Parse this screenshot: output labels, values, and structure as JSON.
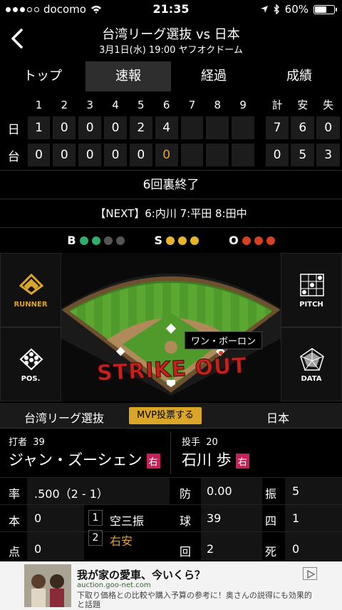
{
  "status": {
    "carrier": "docomo",
    "time": "21:35",
    "battery": "60%"
  },
  "header": {
    "title": "台湾リーグ選抜 vs 日本",
    "subtitle": "3月1日(水) 19:00 ヤフオクドーム"
  },
  "tabs": [
    "トップ",
    "速報",
    "経過",
    "成績"
  ],
  "scoreboard": {
    "innings": [
      "1",
      "2",
      "3",
      "4",
      "5",
      "6",
      "7",
      "8",
      "9"
    ],
    "totals_headers": [
      "計",
      "安",
      "失"
    ],
    "teams": [
      {
        "abbr": "日",
        "runs": [
          "1",
          "0",
          "0",
          "0",
          "2",
          "4",
          "",
          "",
          ""
        ],
        "totals": [
          "7",
          "6",
          "0"
        ]
      },
      {
        "abbr": "台",
        "runs": [
          "0",
          "0",
          "0",
          "0",
          "0",
          "0",
          "",
          "",
          ""
        ],
        "totals": [
          "0",
          "5",
          "3"
        ]
      }
    ]
  },
  "inning_status": "6回裏終了",
  "next_batters": "【NEXT】6:内川  7:平田  8:田中",
  "count": {
    "b_label": "B",
    "s_label": "S",
    "o_label": "O",
    "balls": 2,
    "strikes": 3,
    "outs": 3,
    "colors": {
      "ball": "#2fae6a",
      "strike": "#e8b52a",
      "out": "#d64020",
      "off": "#555555"
    }
  },
  "field": {
    "fielder_label": "ワン・ボーロン",
    "result_text": "STRIKE OUT"
  },
  "side_buttons": {
    "runner": "RUNNER",
    "pos": "POS.",
    "pitch": "PITCH",
    "data": "DATA"
  },
  "teams_bar": {
    "home": "台湾リーグ選抜",
    "mvp": "MVP投票する",
    "away": "日本"
  },
  "batter": {
    "role": "打者",
    "number": "39",
    "name": "ジャン・ズーシェン",
    "hand": "右"
  },
  "pitcher": {
    "role": "投手",
    "number": "20",
    "name": "石川 歩",
    "hand": "右"
  },
  "batter_stats": {
    "avg_label": "率",
    "avg": ".500（2 - 1）",
    "hr_label": "本",
    "hr": "0",
    "rbi_label": "点",
    "rbi": "0",
    "at_bats": [
      {
        "n": "1",
        "result": "空三振"
      },
      {
        "n": "2",
        "result": "右安"
      }
    ]
  },
  "pitcher_stats": {
    "era_label": "防",
    "era": "0.00",
    "k_label": "振",
    "k": "5",
    "pitches_label": "球",
    "pitches": "39",
    "bb_label": "四",
    "bb": "1",
    "ip_label": "回",
    "ip": "2",
    "dead_label": "死",
    "dead": "0"
  },
  "ad": {
    "headline": "我が家の愛車、今いくら？",
    "url": "auction.goo-net.com",
    "desc": "下取り価格との比較や購入予算の参考に！奥さんの説得にも効果的と話題"
  }
}
